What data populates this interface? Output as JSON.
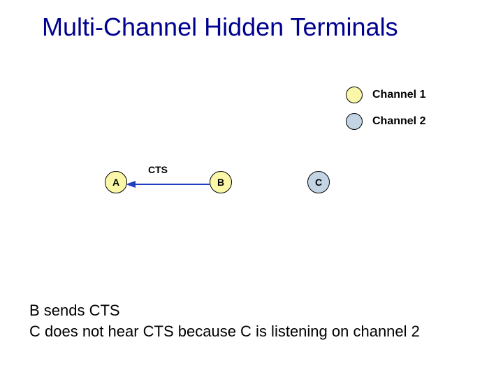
{
  "title": "Multi-Channel Hidden Terminals",
  "legend": {
    "ch1": {
      "label": "Channel 1",
      "color": "#faf8a8"
    },
    "ch2": {
      "label": "Channel 2",
      "color": "#c3d5e5"
    }
  },
  "nodes": {
    "a": {
      "label": "A",
      "channel": "ch1"
    },
    "b": {
      "label": "B",
      "channel": "ch1"
    },
    "c": {
      "label": "C",
      "channel": "ch2"
    }
  },
  "arrow": {
    "label": "CTS",
    "from": "B",
    "to": "A",
    "color": "#1f3fbf"
  },
  "caption": {
    "line1": "B sends CTS",
    "line2": "C does not hear CTS because C is listening on channel 2"
  }
}
